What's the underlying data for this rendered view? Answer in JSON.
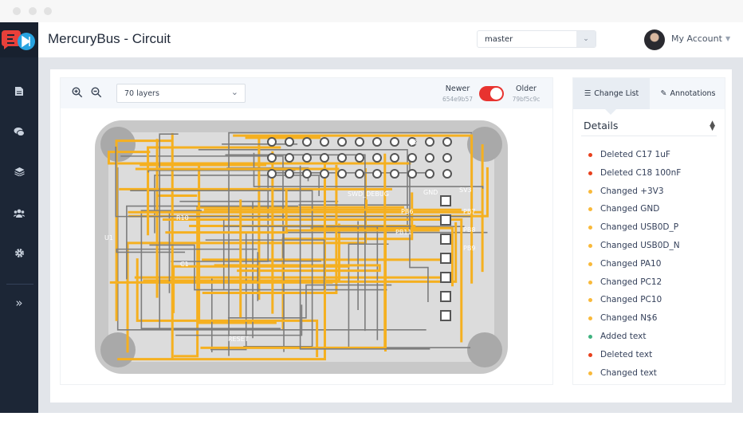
{
  "window": {
    "dots": 3
  },
  "header": {
    "title": "MercuryBus - Circuit",
    "branch": "master",
    "account": "My Account"
  },
  "sidebar": {
    "items": [
      {
        "icon": "file-icon"
      },
      {
        "icon": "chat-icon"
      },
      {
        "icon": "layers-icon"
      },
      {
        "icon": "users-icon"
      },
      {
        "icon": "gear-icon"
      },
      {
        "icon": "double-chevron-right-icon"
      }
    ]
  },
  "toolbar": {
    "layers": "70 layers",
    "newer_label": "Newer",
    "newer_hash": "654e9b57",
    "older_label": "Older",
    "older_hash": "79bf5c9c",
    "toggle_on": true
  },
  "tabs": [
    {
      "label": "Change List",
      "active": true
    },
    {
      "label": "Annotations",
      "active": false
    }
  ],
  "details": {
    "title": "Details"
  },
  "colors": {
    "deleted": "#e8401c",
    "changed": "#f9b93a",
    "added": "#3fb27f",
    "toggle": "#e8332f",
    "trace": "#f5b020",
    "sidebar": "#1c2636"
  },
  "changes": [
    {
      "type": "deleted",
      "text": "Deleted C17 1uF"
    },
    {
      "type": "deleted",
      "text": "Deleted C18 100nF"
    },
    {
      "type": "changed",
      "text": "Changed +3V3"
    },
    {
      "type": "changed",
      "text": "Changed GND"
    },
    {
      "type": "changed",
      "text": "Changed USB0D_P"
    },
    {
      "type": "changed",
      "text": "Changed USB0D_N"
    },
    {
      "type": "changed",
      "text": "Changed PA10"
    },
    {
      "type": "changed",
      "text": "Changed PC12"
    },
    {
      "type": "changed",
      "text": "Changed PC10"
    },
    {
      "type": "changed",
      "text": "Changed N$6"
    },
    {
      "type": "added",
      "text": "Added text"
    },
    {
      "type": "deleted",
      "text": "Deleted text"
    },
    {
      "type": "changed",
      "text": "Changed text"
    }
  ],
  "pcb_labels": [
    "J3",
    "GND",
    "SWD_DEBUG",
    "PB6",
    "PB7",
    "PB8",
    "PB9",
    "PB11",
    "U1",
    "C1",
    "RESET",
    "SV3",
    "R10"
  ]
}
